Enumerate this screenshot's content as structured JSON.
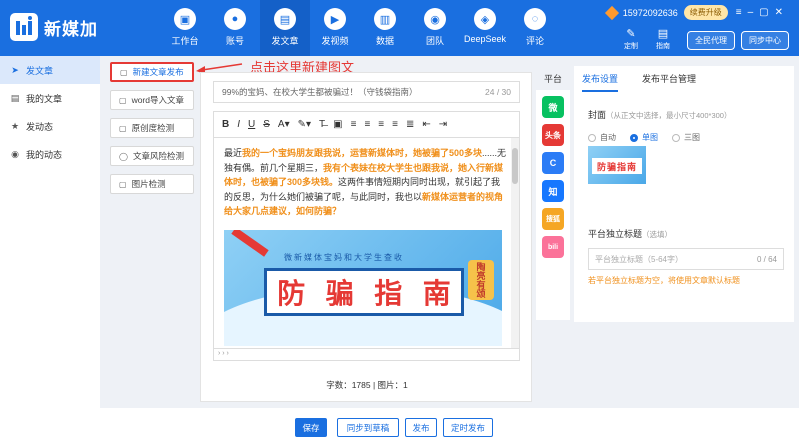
{
  "app": {
    "name": "新媒加"
  },
  "nav": [
    {
      "label": "工作台",
      "icon": "▣"
    },
    {
      "label": "账号",
      "icon": "●"
    },
    {
      "label": "发文章",
      "icon": "▤"
    },
    {
      "label": "发视频",
      "icon": "▶"
    },
    {
      "label": "数据",
      "icon": "▥"
    },
    {
      "label": "团队",
      "icon": "◉"
    },
    {
      "label": "DeepSeek",
      "icon": "◈"
    },
    {
      "label": "评论",
      "icon": "◌"
    }
  ],
  "header": {
    "phone": "15972092636",
    "renew": "续费升级",
    "tools": [
      {
        "label": "定制",
        "icon": "✎"
      },
      {
        "label": "指南",
        "icon": "▤"
      }
    ],
    "agent_btn": "全民代理",
    "sync_btn": "同步中心"
  },
  "sidebar": {
    "items": [
      {
        "label": "发文章",
        "icon": "➤"
      },
      {
        "label": "我的文章",
        "icon": "▤"
      },
      {
        "label": "发动态",
        "icon": "★"
      },
      {
        "label": "我的动态",
        "icon": "◉"
      }
    ]
  },
  "tools": [
    {
      "label": "新建文章发布",
      "icon": "▢"
    },
    {
      "label": "word导入文章",
      "icon": "▢"
    },
    {
      "label": "原创度检测",
      "icon": "▢"
    },
    {
      "label": "文章风险检测",
      "icon": "◯"
    },
    {
      "label": "图片检测",
      "icon": "▢"
    }
  ],
  "annotation": "点击这里新建图文",
  "editor": {
    "title": "99%的宝妈、在校大学生都被骗过！（守钱袋指南）",
    "title_count": "24 / 30",
    "toolbar": [
      "B",
      "I",
      "U",
      "S",
      "A▾",
      "✎▾",
      "T̶",
      "▣",
      "≡",
      "≡",
      "≡",
      "≡",
      "≣",
      "⇤",
      "⇥"
    ],
    "para1": "最近",
    "hl1": "我的一个宝妈朋友跟我说，运营新媒体时，她被骗了500多块",
    "para2": "......无独有偶。前几个星期三，",
    "hl2": "我有个表妹在校大学生也跟我说，她入行新媒体时，也被骗了300多块钱。",
    "para3": "这两件事情短期内同时出现，就引起了我的反思，为什么她们被骗了呢，与此同时，我也以",
    "hl3": "新媒体运营者的视角给大家几点建议，如何防骗？",
    "banner_sub": "微新媒体宝妈和大学生查收",
    "banner_chars": [
      "防",
      "骗",
      "指",
      "南"
    ],
    "banner_tag": "陶亮有颂",
    "path": "› › ›",
    "stats": "字数：1785 | 图片：1"
  },
  "platforms": {
    "header": "平台",
    "items": [
      {
        "name": "wechat",
        "color": "#07c160",
        "glyph": "微"
      },
      {
        "name": "toutiao",
        "color": "#e53935",
        "glyph": "头条"
      },
      {
        "name": "baijia",
        "color": "#2b7cf6",
        "glyph": "C"
      },
      {
        "name": "zhihu",
        "color": "#1677ff",
        "glyph": "知"
      },
      {
        "name": "sohu",
        "color": "#f5a623",
        "glyph": "搜狐"
      },
      {
        "name": "bilibili",
        "color": "#fb7299",
        "glyph": "bili"
      }
    ]
  },
  "settings": {
    "tabs": [
      "发布设置",
      "发布平台管理"
    ],
    "cover_label": "封面",
    "cover_hint": "（从正文中选择，最小尺寸400*300）",
    "radios": [
      "自动",
      "单图",
      "三图"
    ],
    "cover_text": "防骗指南",
    "subtitle_label": "平台独立标题",
    "subtitle_hint": "（选填）",
    "subtitle_placeholder": "平台独立标题（5-64字）",
    "subtitle_count": "0 / 64",
    "warn": "若平台独立标题为空，将使用文章默认标题"
  },
  "actions": [
    "保存",
    "同步到草稿",
    "发布",
    "定时发布"
  ]
}
